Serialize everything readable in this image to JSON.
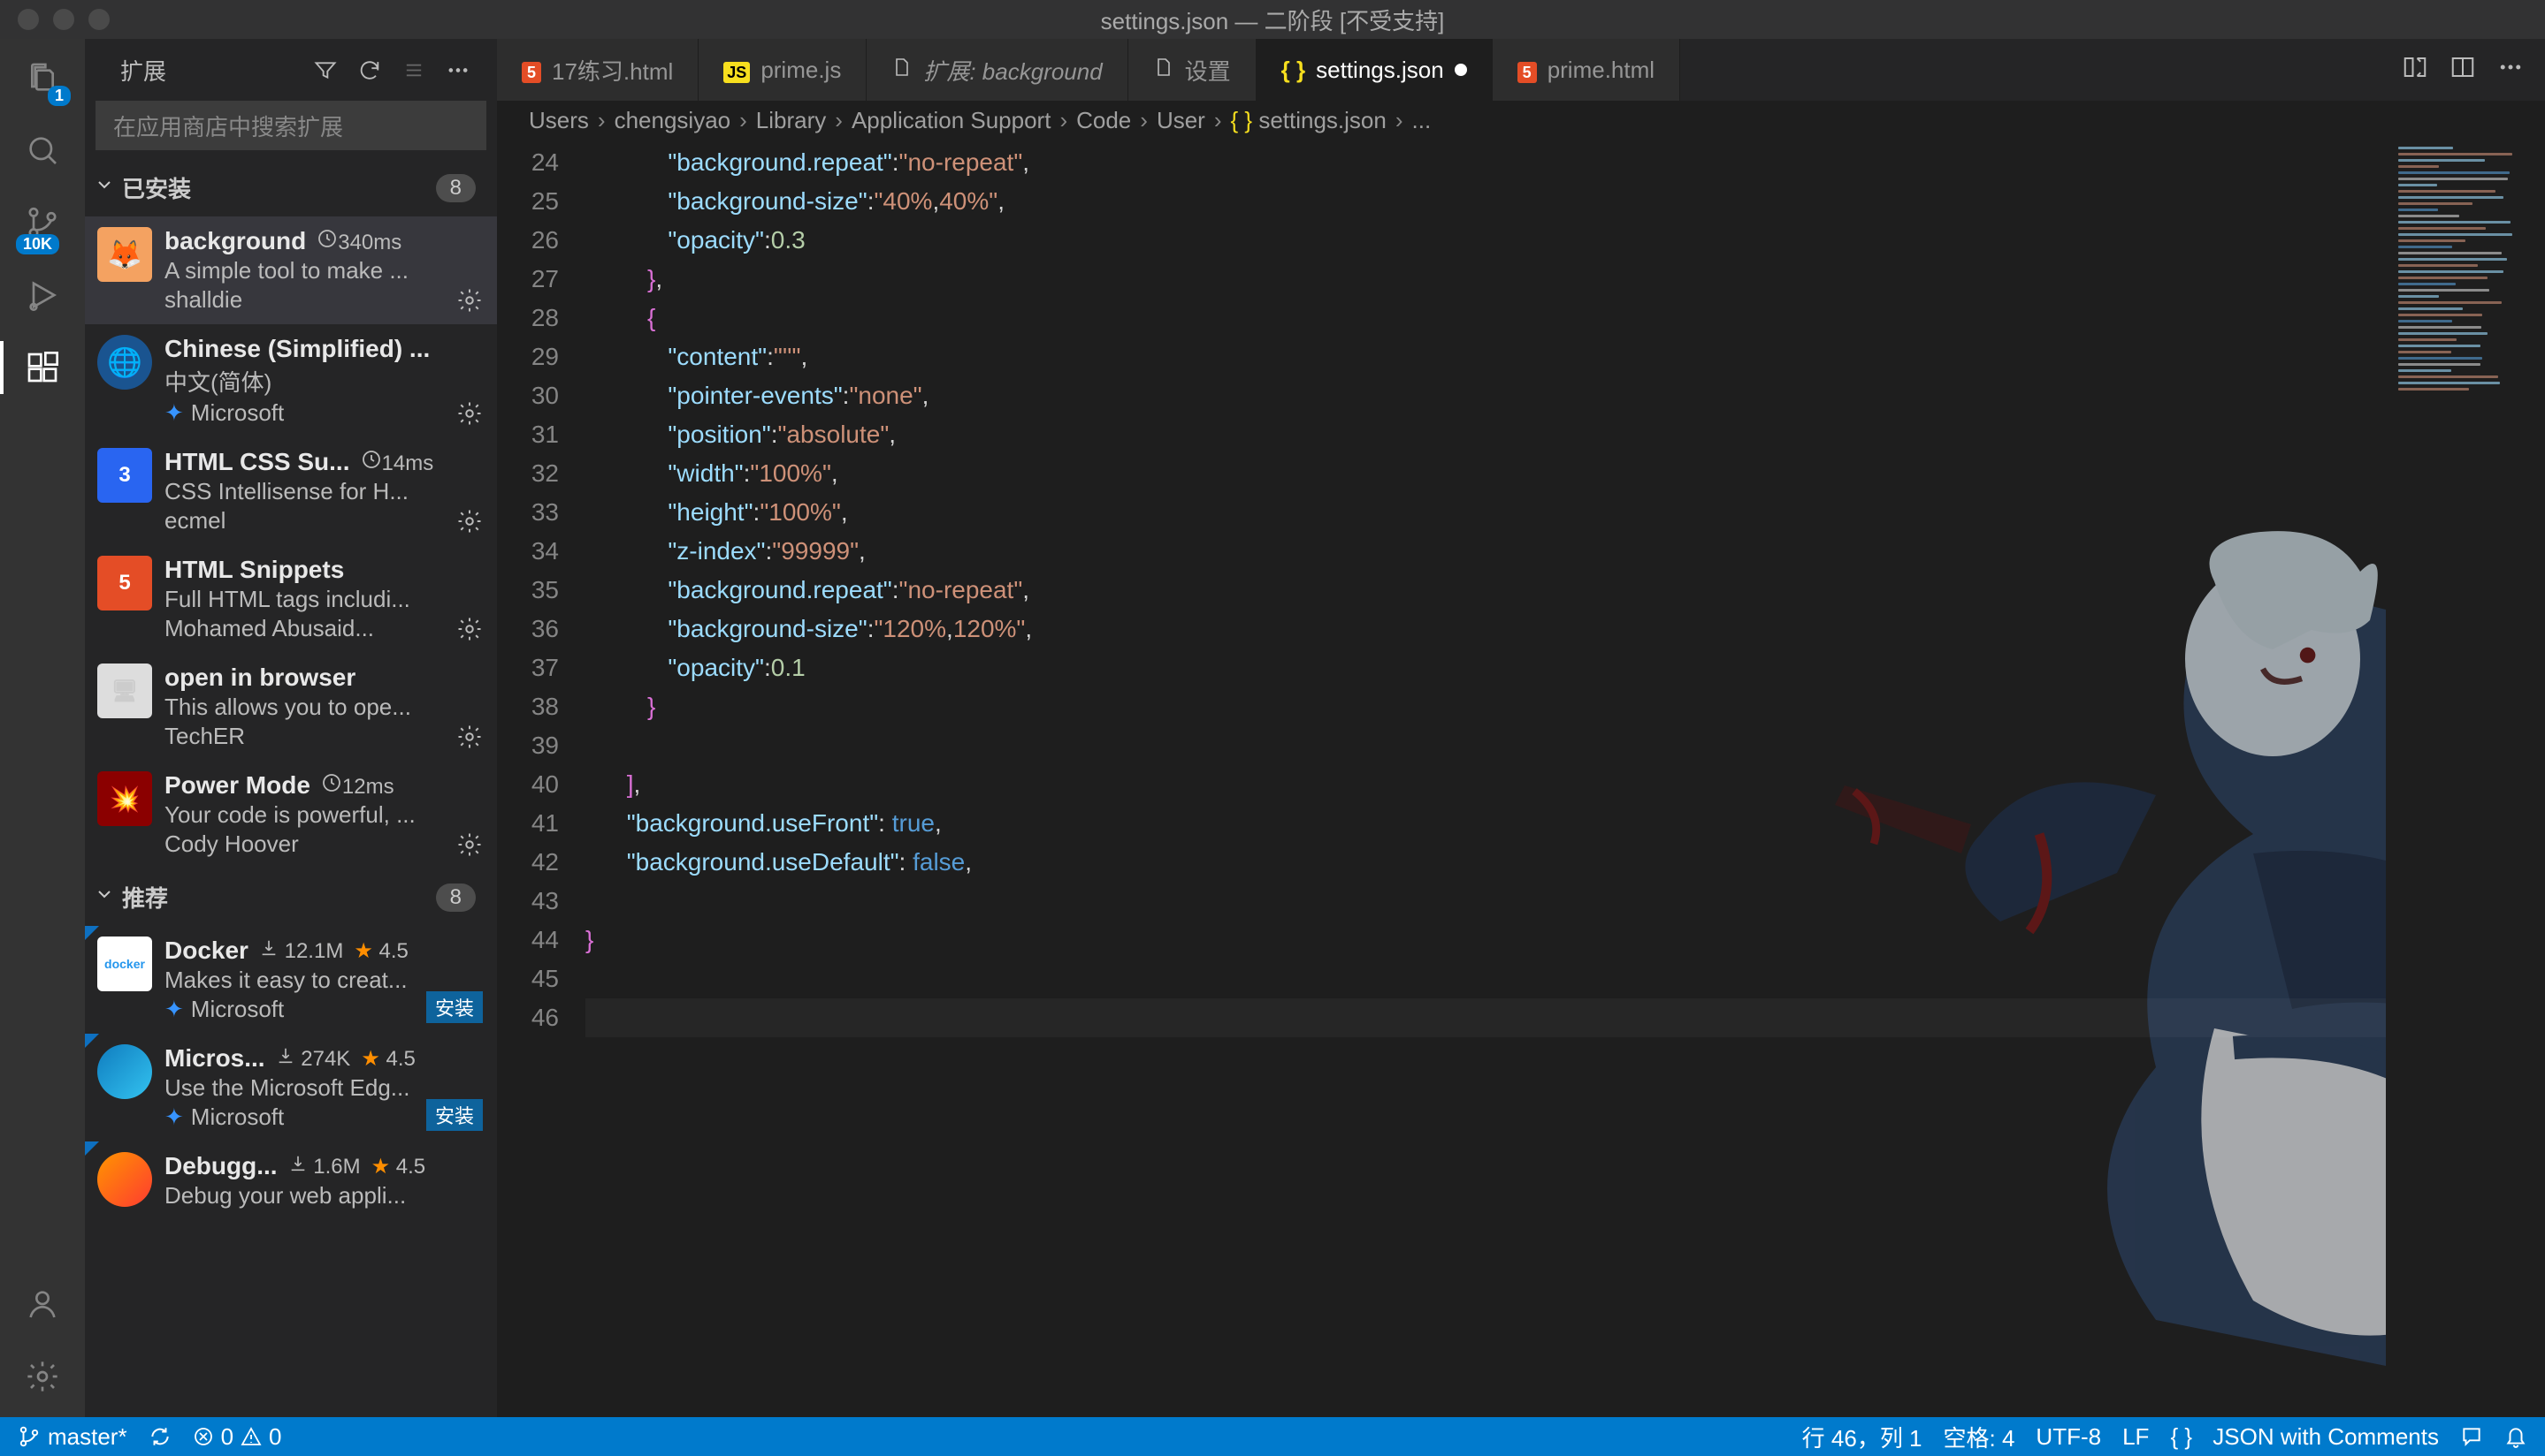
{
  "window": {
    "title": "settings.json — 二阶段 [不受支持]"
  },
  "activity": {
    "badge_files": "1",
    "badge_git": "10K"
  },
  "sidebar": {
    "title": "扩展",
    "search_placeholder": "在应用商店中搜索扩展",
    "installed_label": "已安装",
    "installed_count": "8",
    "recommended_label": "推荐",
    "recommended_count": "8",
    "installed": [
      {
        "name": "background",
        "meta": "340ms",
        "desc": "A simple tool to make ...",
        "publisher": "shalldie"
      },
      {
        "name": "Chinese (Simplified) ...",
        "meta": "",
        "desc": "中文(简体)",
        "publisher": "Microsoft"
      },
      {
        "name": "HTML CSS Su...",
        "meta": "14ms",
        "desc": "CSS Intellisense for H...",
        "publisher": "ecmel"
      },
      {
        "name": "HTML Snippets",
        "meta": "",
        "desc": "Full HTML tags includi...",
        "publisher": "Mohamed Abusaid..."
      },
      {
        "name": "open in browser",
        "meta": "",
        "desc": "This allows you to ope...",
        "publisher": "TechER"
      },
      {
        "name": "Power Mode",
        "meta": "12ms",
        "desc": "Your code is powerful, ...",
        "publisher": "Cody Hoover"
      }
    ],
    "recommended": [
      {
        "name": "Docker",
        "downloads": "12.1M",
        "rating": "4.5",
        "desc": "Makes it easy to creat...",
        "publisher": "Microsoft",
        "install": "安装"
      },
      {
        "name": "Micros...",
        "downloads": "274K",
        "rating": "4.5",
        "desc": "Use the Microsoft Edg...",
        "publisher": "Microsoft",
        "install": "安装"
      },
      {
        "name": "Debugg...",
        "downloads": "1.6M",
        "rating": "4.5",
        "desc": "Debug your web appli...",
        "publisher": "",
        "install": ""
      }
    ]
  },
  "tabs": [
    {
      "label": "17练习.html",
      "icon": "html"
    },
    {
      "label": "prime.js",
      "icon": "js"
    },
    {
      "label": "扩展: background",
      "icon": "file",
      "italic": true
    },
    {
      "label": "设置",
      "icon": "file"
    },
    {
      "label": "settings.json",
      "icon": "json",
      "active": true,
      "dirty": true
    },
    {
      "label": "prime.html",
      "icon": "html"
    }
  ],
  "breadcrumb": [
    "Users",
    "chengsiyao",
    "Library",
    "Application Support",
    "Code",
    "User",
    "settings.json",
    "..."
  ],
  "code": {
    "start": 24,
    "lines": [
      "            \"background.repeat\":\"no-repeat\",",
      "            \"background-size\":\"40%,40%\",",
      "            \"opacity\":0.3",
      "         },",
      "         {",
      "            \"content\":\"''\",",
      "            \"pointer-events\":\"none\",",
      "            \"position\":\"absolute\",",
      "            \"width\":\"100%\",",
      "            \"height\":\"100%\",",
      "            \"z-index\":\"99999\",",
      "            \"background.repeat\":\"no-repeat\",",
      "            \"background-size\":\"120%,120%\",",
      "            \"opacity\":0.1",
      "         }",
      "",
      "      ],",
      "      \"background.useFront\": true,",
      "      \"background.useDefault\": false,",
      "",
      "}",
      "",
      ""
    ]
  },
  "status": {
    "branch": "master*",
    "errors": "0",
    "warnings": "0",
    "position": "行 46，列 1",
    "spaces": "空格: 4",
    "encoding": "UTF-8",
    "eol": "LF",
    "language": "JSON with Comments"
  }
}
